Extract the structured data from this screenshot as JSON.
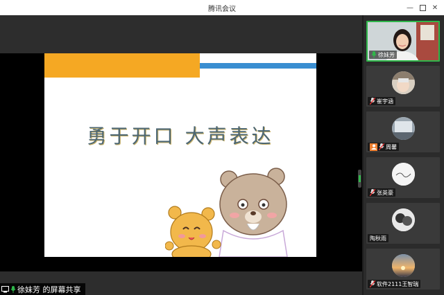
{
  "window": {
    "title": "腾讯会议",
    "controls": [
      "minimize-icon",
      "maximize-icon",
      "close-icon"
    ]
  },
  "slide": {
    "headline": "勇于开口  大声表达",
    "colors": {
      "orange": "#f5a823",
      "blue": "#3a8ed1"
    }
  },
  "share_label": {
    "text": "徐妹芳 的屏幕共享"
  },
  "participants": [
    {
      "name": "徐妹芳",
      "active": true,
      "mic": "on"
    },
    {
      "name": "崔宇涵",
      "active": false,
      "mic": "muted"
    },
    {
      "name": "周馨",
      "active": false,
      "mic": "muted"
    },
    {
      "name": "张英豪",
      "active": false,
      "mic": "muted"
    },
    {
      "name": "陶秋雨",
      "active": false,
      "mic": "none"
    },
    {
      "name": "软件2111王智瑞",
      "active": false,
      "mic": "muted"
    }
  ],
  "accent": "#2fb64a"
}
